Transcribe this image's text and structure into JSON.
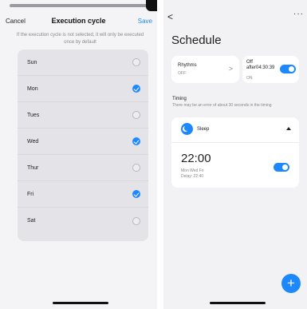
{
  "left": {
    "header": {
      "cancel": "Cancel",
      "title": "Execution cycle",
      "save": "Save"
    },
    "hint": "If the execution cycle is not selected, it will only be executed once by default",
    "days": [
      {
        "name": "Sun",
        "checked": false
      },
      {
        "name": "Mon",
        "checked": true
      },
      {
        "name": "Tues",
        "checked": false
      },
      {
        "name": "Wed",
        "checked": true
      },
      {
        "name": "Thur",
        "checked": false
      },
      {
        "name": "Fri",
        "checked": true
      },
      {
        "name": "Sat",
        "checked": false
      }
    ]
  },
  "right": {
    "back": "<",
    "more": "···",
    "title": "Schedule",
    "rhythms": {
      "title": "Rhythms",
      "status": "OFF",
      "arrow": ">"
    },
    "off_after": {
      "title": "Off after04:30:39",
      "status": "ON",
      "toggle_on": true
    },
    "timing": {
      "title": "Timing",
      "note": "There may be an error of about 30 seconds in the timing"
    },
    "sleep": {
      "label": "Sleep",
      "time": "22:00",
      "days": "Mon Wed Fri",
      "delay": "Delay: 22:40",
      "toggle_on": true
    },
    "fab": "+"
  },
  "colors": {
    "accent": "#1e88ff"
  }
}
